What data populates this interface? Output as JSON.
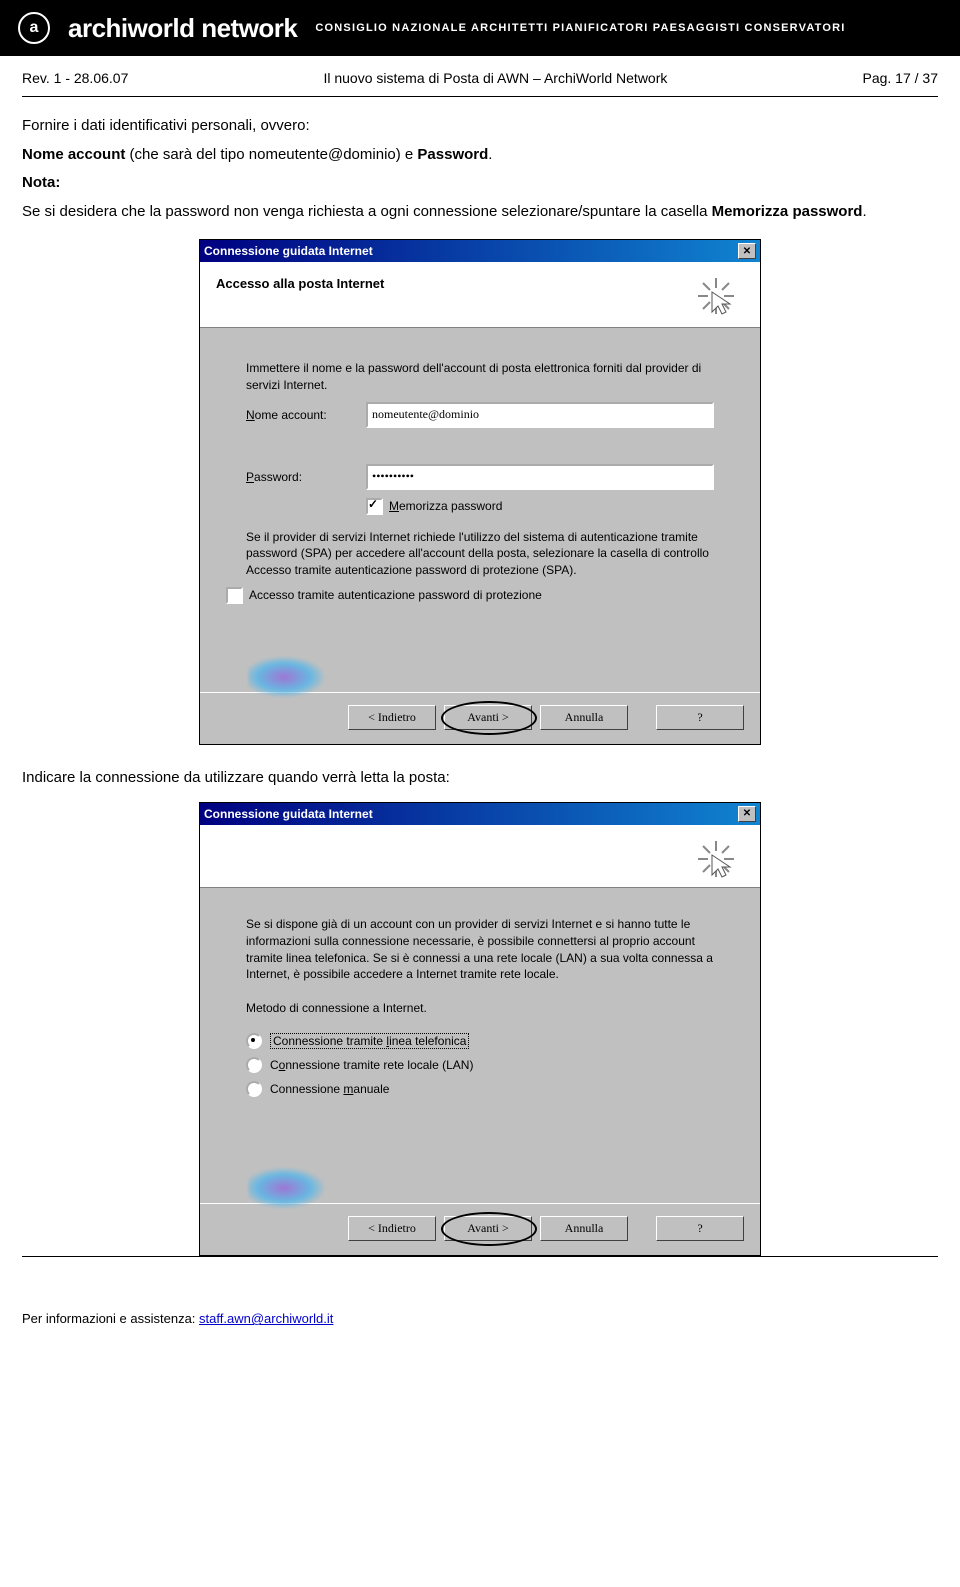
{
  "banner": {
    "logo_letter": "a",
    "logo_text": "archiworld network",
    "tagline": "CONSIGLIO NAZIONALE ARCHITETTI PIANIFICATORI PAESAGGISTI CONSERVATORI"
  },
  "header": {
    "rev": "Rev. 1 - 28.06.07",
    "title": "Il nuovo sistema di Posta di AWN – ArchiWorld Network",
    "page": "Pag. 17 / 37"
  },
  "intro": {
    "line1": "Fornire i dati identificativi personali, ovvero:",
    "line2a": "Nome account",
    "line2b": " (che sarà del tipo nomeutente@dominio) e ",
    "line2c": "Password",
    "note_label": "Nota:",
    "note_body1": "Se si desidera che la password non venga richiesta a ogni connessione selezionare/spuntare la casella ",
    "note_body2": "Memorizza password",
    "dot": "."
  },
  "dialog1": {
    "title": "Connessione guidata Internet",
    "close": "✕",
    "step_title": "Accesso alla posta Internet",
    "intro": "Immettere il nome e la password dell'account di posta elettronica forniti dal provider di servizi Internet.",
    "account_label": "Nome account:",
    "account_value": "nomeutente@dominio",
    "password_label": "Password:",
    "password_value": "••••••••••",
    "remember_label": "Memorizza password",
    "spa_desc": "Se il provider di servizi Internet richiede l'utilizzo del sistema di autenticazione tramite password (SPA) per accedere all'account della posta, selezionare la casella di controllo Accesso tramite autenticazione password di protezione (SPA).",
    "spa_check": "Accesso tramite autenticazione password di protezione",
    "btn_back": "< Indietro",
    "btn_next": "Avanti >",
    "btn_cancel": "Annulla",
    "btn_help": "?"
  },
  "section2_text": "Indicare la connessione da utilizzare quando verrà letta la posta:",
  "dialog2": {
    "title": "Connessione guidata Internet",
    "close": "✕",
    "desc": "Se si dispone già di un account con un provider di servizi Internet e si hanno tutte le informazioni sulla connessione necessarie, è possibile connettersi al proprio account tramite linea telefonica. Se si è connessi a una rete locale (LAN) a sua volta connessa a Internet, è possibile accedere a Internet tramite rete locale.",
    "method_label": "Metodo di connessione a Internet.",
    "opt1": "Connessione tramite linea telefonica",
    "opt2": "Connessione tramite rete locale (LAN)",
    "opt3": "Connessione manuale",
    "btn_back": "< Indietro",
    "btn_next": "Avanti >",
    "btn_cancel": "Annulla",
    "btn_help": "?"
  },
  "footer": {
    "text": "Per informazioni e assistenza: ",
    "email": "staff.awn@archiworld.it"
  }
}
